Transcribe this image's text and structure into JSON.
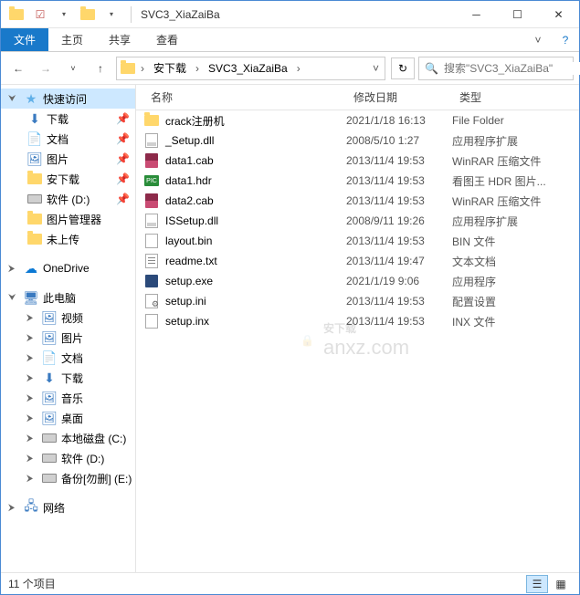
{
  "titlebar": {
    "title": "SVC3_XiaZaiBa"
  },
  "ribbon": {
    "file": "文件",
    "tabs": [
      "主页",
      "共享",
      "查看"
    ]
  },
  "breadcrumb": {
    "segments": [
      "安下载",
      "SVC3_XiaZaiBa"
    ]
  },
  "search": {
    "placeholder": "搜索\"SVC3_XiaZaiBa\""
  },
  "sidebar": {
    "quick": "快速访问",
    "quick_items": [
      {
        "label": "下载",
        "icon": "dl",
        "pin": true
      },
      {
        "label": "文档",
        "icon": "doc",
        "pin": true
      },
      {
        "label": "图片",
        "icon": "img",
        "pin": true
      },
      {
        "label": "安下载",
        "icon": "folder",
        "pin": true
      },
      {
        "label": "软件 (D:)",
        "icon": "drive",
        "pin": true
      },
      {
        "label": "图片管理器",
        "icon": "folder",
        "pin": false
      },
      {
        "label": "未上传",
        "icon": "folder",
        "pin": false
      }
    ],
    "onedrive": "OneDrive",
    "thispc": "此电脑",
    "pc_items": [
      {
        "label": "视频",
        "icon": "img"
      },
      {
        "label": "图片",
        "icon": "img"
      },
      {
        "label": "文档",
        "icon": "doc"
      },
      {
        "label": "下载",
        "icon": "dl"
      },
      {
        "label": "音乐",
        "icon": "img"
      },
      {
        "label": "桌面",
        "icon": "img"
      },
      {
        "label": "本地磁盘 (C:)",
        "icon": "drive"
      },
      {
        "label": "软件 (D:)",
        "icon": "drive"
      },
      {
        "label": "备份[勿删] (E:)",
        "icon": "drive"
      }
    ],
    "network": "网络"
  },
  "columns": {
    "name": "名称",
    "date": "修改日期",
    "type": "类型"
  },
  "files": [
    {
      "name": "crack注册机",
      "date": "2021/1/18 16:13",
      "type": "File Folder",
      "icon": "folder"
    },
    {
      "name": "_Setup.dll",
      "date": "2008/5/10 1:27",
      "type": "应用程序扩展",
      "icon": "dll"
    },
    {
      "name": "data1.cab",
      "date": "2013/11/4 19:53",
      "type": "WinRAR 压缩文件",
      "icon": "rar"
    },
    {
      "name": "data1.hdr",
      "date": "2013/11/4 19:53",
      "type": "看图王 HDR 图片...",
      "icon": "pic"
    },
    {
      "name": "data2.cab",
      "date": "2013/11/4 19:53",
      "type": "WinRAR 压缩文件",
      "icon": "rar"
    },
    {
      "name": "ISSetup.dll",
      "date": "2008/9/11 19:26",
      "type": "应用程序扩展",
      "icon": "dll"
    },
    {
      "name": "layout.bin",
      "date": "2013/11/4 19:53",
      "type": "BIN 文件",
      "icon": "blank"
    },
    {
      "name": "readme.txt",
      "date": "2013/11/4 19:47",
      "type": "文本文档",
      "icon": "txt"
    },
    {
      "name": "setup.exe",
      "date": "2021/1/19 9:06",
      "type": "应用程序",
      "icon": "exe"
    },
    {
      "name": "setup.ini",
      "date": "2013/11/4 19:53",
      "type": "配置设置",
      "icon": "ini"
    },
    {
      "name": "setup.inx",
      "date": "2013/11/4 19:53",
      "type": "INX 文件",
      "icon": "blank"
    }
  ],
  "status": {
    "count": "11 个项目"
  },
  "watermark": {
    "main": "安下载",
    "sub": "anxz.com"
  }
}
